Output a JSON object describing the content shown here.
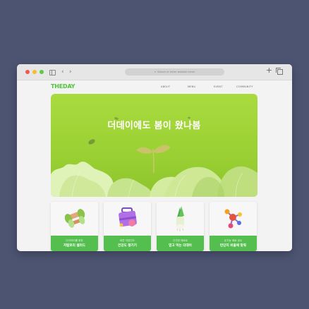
{
  "browser": {
    "address_placeholder": "Search or enter website name"
  },
  "site": {
    "logo": "THEDAY",
    "nav": [
      "ABOUT",
      "MENU",
      "EVENT",
      "COMMUNITY"
    ]
  },
  "hero": {
    "title": "더데이에도 봄이 왔나봄"
  },
  "cards": [
    {
      "sub": "다이어터를 위한",
      "main": "저칼로리 샐러드",
      "icon": "dumbbell-icon"
    },
    {
      "sub": "바쁜 직장인도",
      "main": "건강도 챙기기",
      "icon": "briefcase-icon"
    },
    {
      "sub": "신선한 재료로",
      "main": "믿고 먹는 더데이",
      "icon": "leek-icon"
    },
    {
      "sub": "유기농 재료 공수",
      "main": "탄단지 비율에 맞춰",
      "icon": "molecule-icon"
    }
  ],
  "colors": {
    "background": "#4d5472",
    "brand_green": "#4fc43a",
    "hero_green": "#a9db3f",
    "card_banner": "#54bf4f"
  }
}
